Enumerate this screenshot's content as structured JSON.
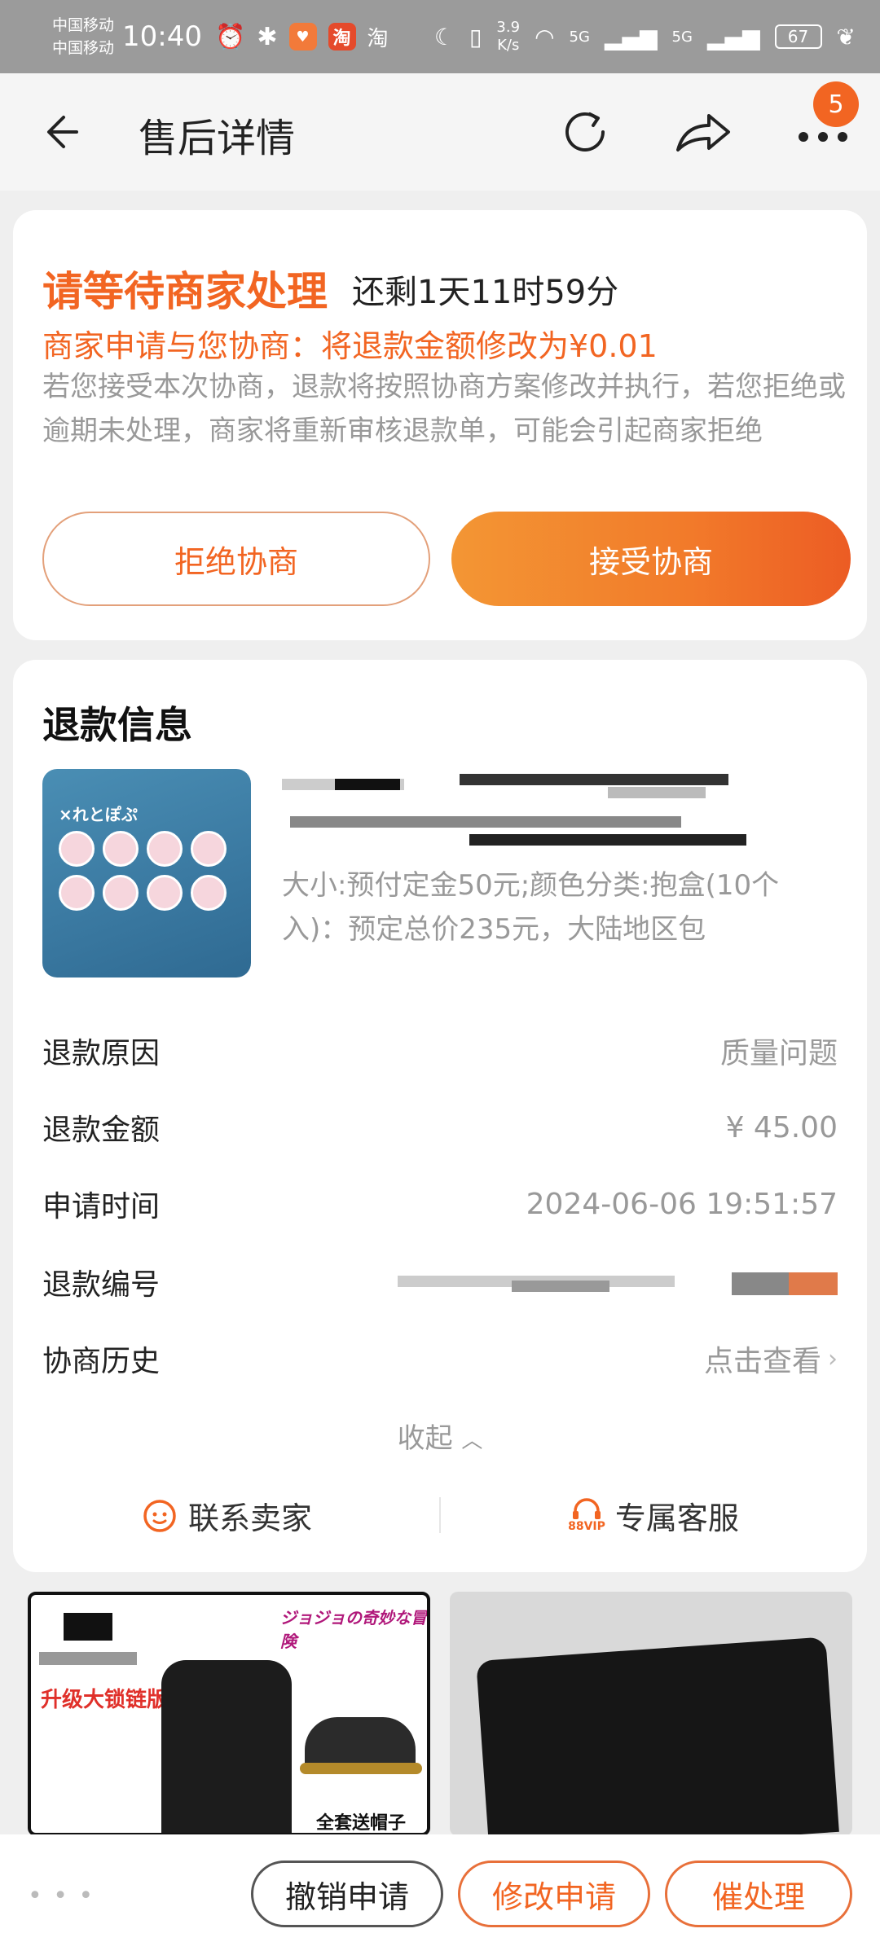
{
  "status_bar": {
    "carrier1": "中国移动",
    "carrier2": "中国移动",
    "time": "10:40",
    "taobao_badge": "淘",
    "taobao_text": "淘",
    "speed_value": "3.9",
    "speed_unit": "K/s",
    "signal1": "5G",
    "signal2": "5G",
    "battery": "67"
  },
  "nav": {
    "title": "售后详情",
    "badge_count": "5"
  },
  "status": {
    "title": "请等待商家处理",
    "remaining": "还剩1天11时59分",
    "offer": "商家申请与您协商：将退款金额修改为¥0.01",
    "description": "若您接受本次协商，退款将按照协商方案修改并执行，若您拒绝或逾期未处理，商家将重新审核退款单，可能会引起商家拒绝",
    "reject_label": "拒绝协商",
    "accept_label": "接受协商"
  },
  "refund": {
    "section_title": "退款信息",
    "product_image_text": "×れとぽぷ",
    "spec": "大小:预付定金50元;颜色分类:抱盒(10个入)：预定总价235元，大陆地区包",
    "rows": [
      {
        "label": "退款原因",
        "value": "质量问题"
      },
      {
        "label": "退款金额",
        "value": "¥ 45.00"
      },
      {
        "label": "申请时间",
        "value": "2024-06-06 19:51:57"
      },
      {
        "label": "退款编号",
        "value": ""
      },
      {
        "label": "协商历史",
        "value": "点击查看"
      }
    ],
    "collapse_label": "收起",
    "contact_seller": "联系卖家",
    "exclusive_service": "专属客服",
    "vip_tag": "88VIP"
  },
  "recommendations": {
    "left_tag": "升级大锁链版",
    "left_logo": "ジョジョの奇妙な冒険",
    "left_note": "全套送帽子"
  },
  "bottom_bar": {
    "cancel_label": "撤销申请",
    "modify_label": "修改申请",
    "urge_label": "催处理"
  },
  "colors": {
    "accent": "#f26522",
    "accent_gradient_start": "#f39634",
    "accent_gradient_end": "#ec5c24",
    "muted_text": "#999999",
    "page_bg": "#efefef"
  }
}
